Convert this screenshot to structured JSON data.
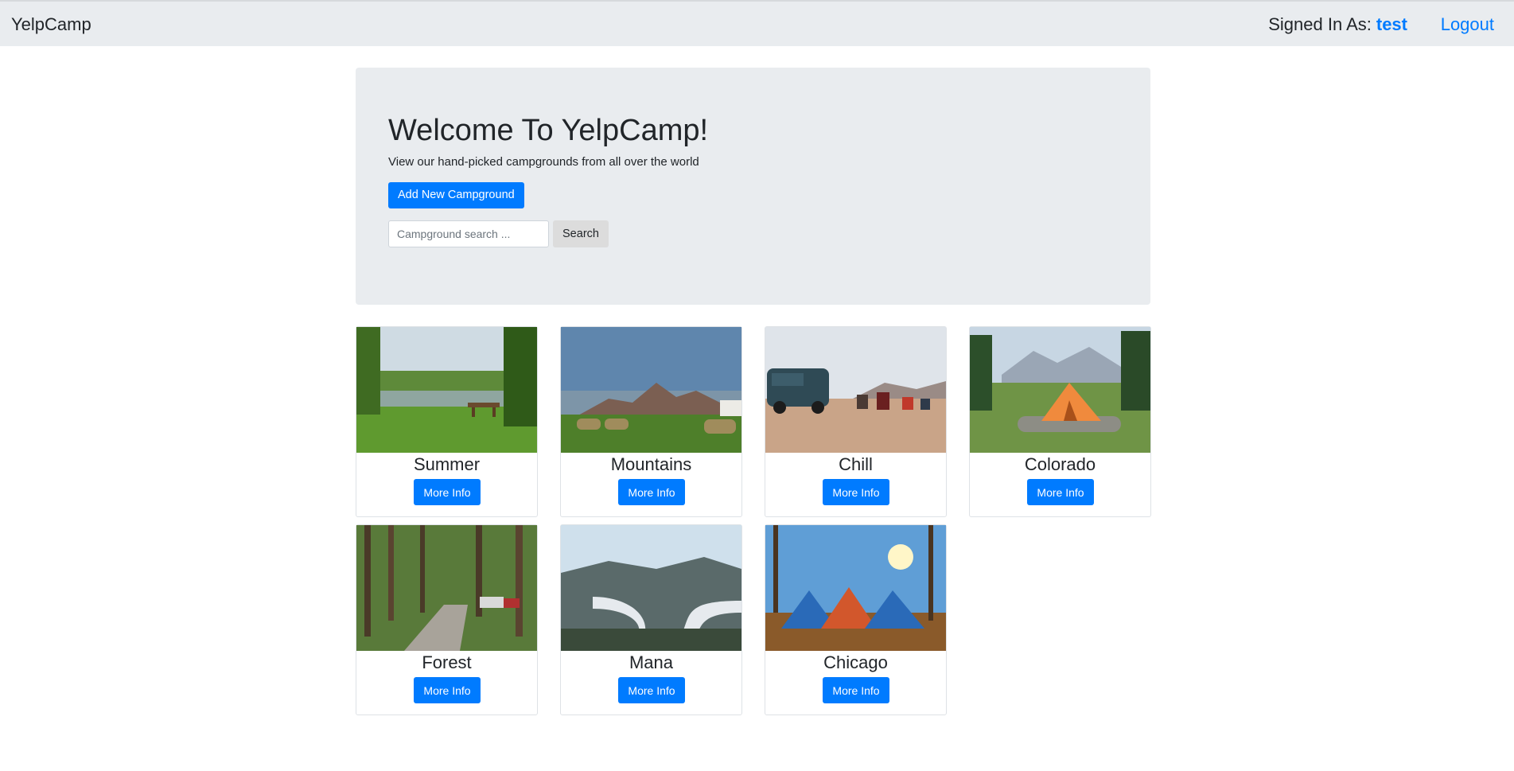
{
  "navbar": {
    "brand": "YelpCamp",
    "signed_in_label": "Signed In As:",
    "username": "test",
    "logout_label": "Logout"
  },
  "hero": {
    "title": "Welcome To YelpCamp!",
    "subtitle": "View our hand-picked campgrounds from all over the world",
    "add_button": "Add New Campground",
    "search_placeholder": "Campground search ...",
    "search_button": "Search"
  },
  "campgrounds": [
    {
      "name": "Summer",
      "button": "More Info"
    },
    {
      "name": "Mountains",
      "button": "More Info"
    },
    {
      "name": "Chill",
      "button": "More Info"
    },
    {
      "name": "Colorado",
      "button": "More Info"
    },
    {
      "name": "Forest",
      "button": "More Info"
    },
    {
      "name": "Mana",
      "button": "More Info"
    },
    {
      "name": "Chicago",
      "button": "More Info"
    }
  ],
  "colors": {
    "primary": "#007bff",
    "navbar_bg": "#e9ecef",
    "jumbotron_bg": "#e9ecef"
  }
}
